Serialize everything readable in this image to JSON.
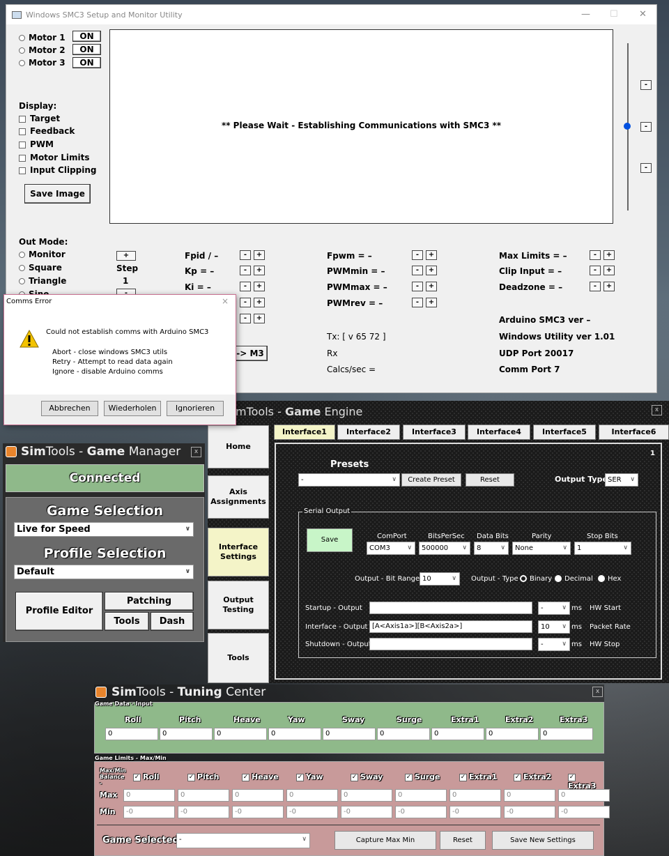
{
  "smc3": {
    "title": "Windows SMC3 Setup and Monitor Utility",
    "motors": [
      {
        "label": "Motor 1",
        "btn": "ON"
      },
      {
        "label": "Motor 2",
        "btn": "ON"
      },
      {
        "label": "Motor 3",
        "btn": "ON"
      }
    ],
    "display_label": "Display:",
    "display_options": [
      "Target",
      "Feedback",
      "PWM",
      "Motor Limits",
      "Input Clipping"
    ],
    "save_image": "Save Image",
    "message": "** Please Wait - Establishing Communications with SMC3 **",
    "out_mode_label": "Out Mode:",
    "out_modes": [
      "Monitor",
      "Square",
      "Triangle",
      "Sine"
    ],
    "step_label": "Step",
    "step_value": "1",
    "col1": [
      "Fpid / –",
      "Kp = –",
      "Ki = –"
    ],
    "col2": [
      "Fpwm = –",
      "PWMmin = –",
      "PWMmax = –",
      "PWMrev = –"
    ],
    "col3": [
      "Max Limits = –",
      "Clip Input = –",
      "Deadzone = –"
    ],
    "m3_btn": "-> M3",
    "tx": "Tx: [ v 65 72 ]",
    "rx": "Rx",
    "calcs": "Calcs/sec =",
    "info": [
      "Arduino SMC3 ver –",
      "Windows Utility ver 1.01",
      "UDP Port 20017",
      "Comm Port 7"
    ]
  },
  "dialog": {
    "title": "Comms Error",
    "close": "×",
    "message": "Could not establish comms with Arduino SMC3",
    "details": [
      "Abort - close windows SMC3 utils",
      "Retry - Attempt to read data again",
      "Ignore - disable Arduino comms"
    ],
    "buttons": [
      "Abbrechen",
      "Wiederholen",
      "Ignorieren"
    ]
  },
  "game_engine": {
    "title_pre": "mTools - ",
    "title_bold": "Game",
    "title_post": " Engine",
    "close": "x",
    "nav": [
      "Home",
      "Axis Assignments",
      "Interface Settings",
      "Output Testing",
      "Tools"
    ],
    "tabs": [
      "Interface1",
      "Interface2",
      "Interface3",
      "Interface4",
      "Interface5",
      "Interface6"
    ],
    "panel_number": "1",
    "presets_label": "Presets",
    "preset_value": "-",
    "create_preset": "Create Preset",
    "reset": "Reset",
    "output_type_label": "Output Type",
    "output_type": "SER",
    "serial_output_label": "Serial Output",
    "save": "Save",
    "comport_label": "ComPort",
    "comport": "COM3",
    "bps_label": "BitsPerSec",
    "bps": "500000",
    "databits_label": "Data Bits",
    "databits": "8",
    "parity_label": "Parity",
    "parity": "None",
    "stopbits_label": "Stop Bits",
    "stopbits": "1",
    "bitrange_label": "Output - Bit Range",
    "bitrange": "10",
    "outtype_label": "Output - Type",
    "outtypes": [
      "Binary",
      "Decimal",
      "Hex"
    ],
    "startup_label": "Startup - Output",
    "startup_val": "",
    "startup_ms": "-",
    "hw_start": "HW Start",
    "interface_label": "Interface - Output",
    "interface_val": "[A<Axis1a>][B<Axis2a>]",
    "interface_ms": "10",
    "packet_rate": "Packet Rate",
    "shutdown_label": "Shutdown - Output",
    "shutdown_val": "",
    "shutdown_ms": "-",
    "hw_stop": "HW Stop",
    "ms": "ms"
  },
  "game_manager": {
    "title_pre": "Sim",
    "title_mid": "Tools - ",
    "title_bold": "Game",
    "title_post": " Manager",
    "close": "x",
    "status": "Connected",
    "game_selection_label": "Game Selection",
    "game": "Live for Speed",
    "profile_selection_label": "Profile Selection",
    "profile": "Default",
    "profile_editor": "Profile Editor",
    "patching": "Patching",
    "tools": "Tools",
    "dash": "Dash"
  },
  "tuning": {
    "title_pre": "Sim",
    "title_mid": "Tools - ",
    "title_bold": "Tuning",
    "title_post": " Center",
    "close": "x",
    "input_label": "Game Data - Input",
    "axes": [
      "Roll",
      "Pitch",
      "Heave",
      "Yaw",
      "Sway",
      "Surge",
      "Extra1",
      "Extra2",
      "Extra3"
    ],
    "inputs": [
      "0",
      "0",
      "0",
      "0",
      "0",
      "0",
      "0",
      "0",
      "0"
    ],
    "limits_label": "Game Limits - Max/Min",
    "balance_label": "Max/Min Balance -",
    "max_label": "Max",
    "min_label": "Min",
    "max_vals": [
      "0",
      "0",
      "0",
      "0",
      "0",
      "0",
      "0",
      "0",
      "0"
    ],
    "min_vals": [
      "-0",
      "-0",
      "-0",
      "-0",
      "-0",
      "-0",
      "-0",
      "-0",
      "-0"
    ],
    "game_selected_label": "Game Selected",
    "game_selected": "-",
    "capture": "Capture Max Min",
    "reset": "Reset",
    "save_new": "Save New Settings"
  },
  "colors": {
    "green_panel": "#8fb98a",
    "pink_panel": "#c89a9a",
    "save_green": "#c8f5c8",
    "interface_btn": "#f4f4c8"
  }
}
